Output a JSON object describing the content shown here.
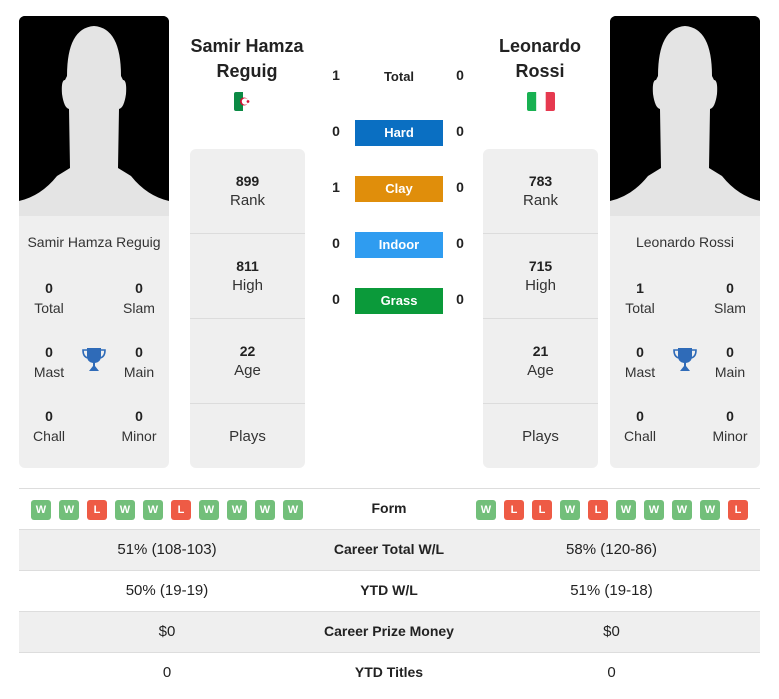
{
  "players": [
    {
      "name_line1": "Samir Hamza",
      "name_line2": "Reguig",
      "full_name": "Samir Hamza Reguig",
      "country": "Algeria",
      "flag_icon": "algeria-flag-icon",
      "rank": "899",
      "rank_label": "Rank",
      "high": "811",
      "high_label": "High",
      "age": "22",
      "age_label": "Age",
      "plays_label": "Plays",
      "titles": {
        "total": "0",
        "total_label": "Total",
        "slam": "0",
        "slam_label": "Slam",
        "mast": "0",
        "mast_label": "Mast",
        "main": "0",
        "main_label": "Main",
        "chall": "0",
        "chall_label": "Chall",
        "minor": "0",
        "minor_label": "Minor"
      },
      "form": [
        "W",
        "W",
        "L",
        "W",
        "W",
        "L",
        "W",
        "W",
        "W",
        "W"
      ]
    },
    {
      "name_line1": "Leonardo",
      "name_line2": "Rossi",
      "full_name": "Leonardo Rossi",
      "country": "Italy",
      "flag_icon": "italy-flag-icon",
      "rank": "783",
      "rank_label": "Rank",
      "high": "715",
      "high_label": "High",
      "age": "21",
      "age_label": "Age",
      "plays_label": "Plays",
      "titles": {
        "total": "1",
        "total_label": "Total",
        "slam": "0",
        "slam_label": "Slam",
        "mast": "0",
        "mast_label": "Mast",
        "main": "0",
        "main_label": "Main",
        "chall": "0",
        "chall_label": "Chall",
        "minor": "0",
        "minor_label": "Minor"
      },
      "form": [
        "W",
        "L",
        "L",
        "W",
        "L",
        "W",
        "W",
        "W",
        "W",
        "L"
      ]
    }
  ],
  "h2h": {
    "total": {
      "label": "Total",
      "left": "1",
      "right": "0"
    },
    "surfaces": [
      {
        "label": "Hard",
        "left": "0",
        "right": "0",
        "color": "#0a6fc2"
      },
      {
        "label": "Clay",
        "left": "1",
        "right": "0",
        "color": "#e08e0b"
      },
      {
        "label": "Indoor",
        "left": "0",
        "right": "0",
        "color": "#2f9cf0"
      },
      {
        "label": "Grass",
        "left": "0",
        "right": "0",
        "color": "#0b9a3a"
      }
    ]
  },
  "comparison": {
    "form_label": "Form",
    "rows": [
      {
        "label": "Career Total W/L",
        "left": "51% (108-103)",
        "right": "58% (120-86)"
      },
      {
        "label": "YTD W/L",
        "left": "50% (19-19)",
        "right": "51% (19-18)"
      },
      {
        "label": "Career Prize Money",
        "left": "$0",
        "right": "$0"
      },
      {
        "label": "YTD Titles",
        "left": "0",
        "right": "0"
      }
    ]
  },
  "colors": {
    "win": "#72bf7a",
    "loss": "#ee5b45",
    "trophy": "#2f6bb8",
    "card_bg": "#efefef"
  }
}
